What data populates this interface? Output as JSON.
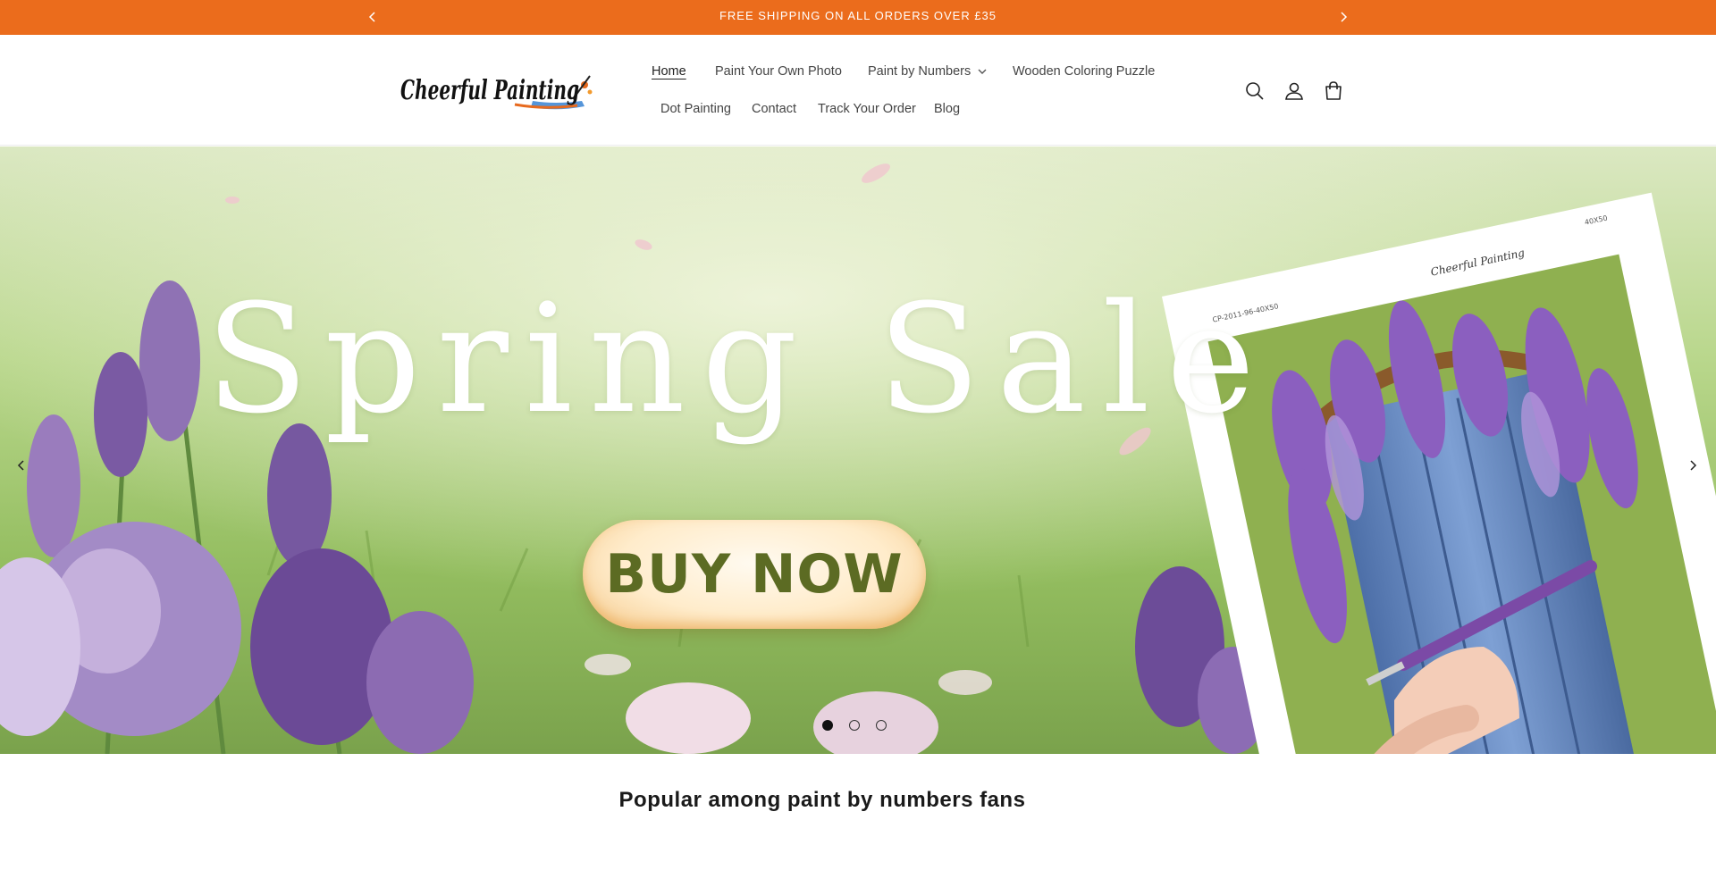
{
  "announcement": {
    "text": "FREE SHIPPING ON ALL ORDERS OVER £35",
    "prev_icon": "chevron-left-icon",
    "next_icon": "chevron-right-icon"
  },
  "header": {
    "logo_text": "Cheerful Painting",
    "nav": [
      {
        "label": "Home",
        "active": true
      },
      {
        "label": "Paint Your Own Photo"
      },
      {
        "label": "Paint by Numbers",
        "has_dropdown": true
      },
      {
        "label": "Wooden Coloring Puzzle"
      },
      {
        "label": "Dot Painting"
      },
      {
        "label": "Contact"
      },
      {
        "label": "Track Your Order"
      },
      {
        "label": "Blog"
      }
    ],
    "icons": [
      "search-icon",
      "account-icon",
      "cart-icon"
    ]
  },
  "hero": {
    "title": "Spring Sale",
    "button_label": "BUY NOW",
    "slide_count": 3,
    "active_slide": 1
  },
  "section": {
    "title": "Popular among paint by numbers fans"
  },
  "colors": {
    "announcement_bg": "#eb6c1c",
    "button_text": "#5c6b23"
  }
}
